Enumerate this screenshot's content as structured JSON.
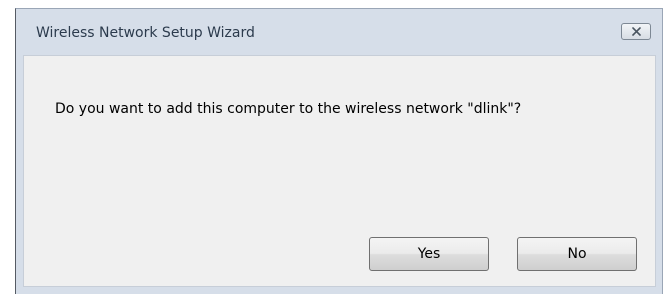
{
  "window": {
    "title": "Wireless Network Setup Wizard"
  },
  "dialog": {
    "message": "Do you want to add this computer to the wireless network \"dlink\"?"
  },
  "buttons": {
    "yes": "Yes",
    "no": "No"
  },
  "icons": {
    "close": "close-icon"
  }
}
